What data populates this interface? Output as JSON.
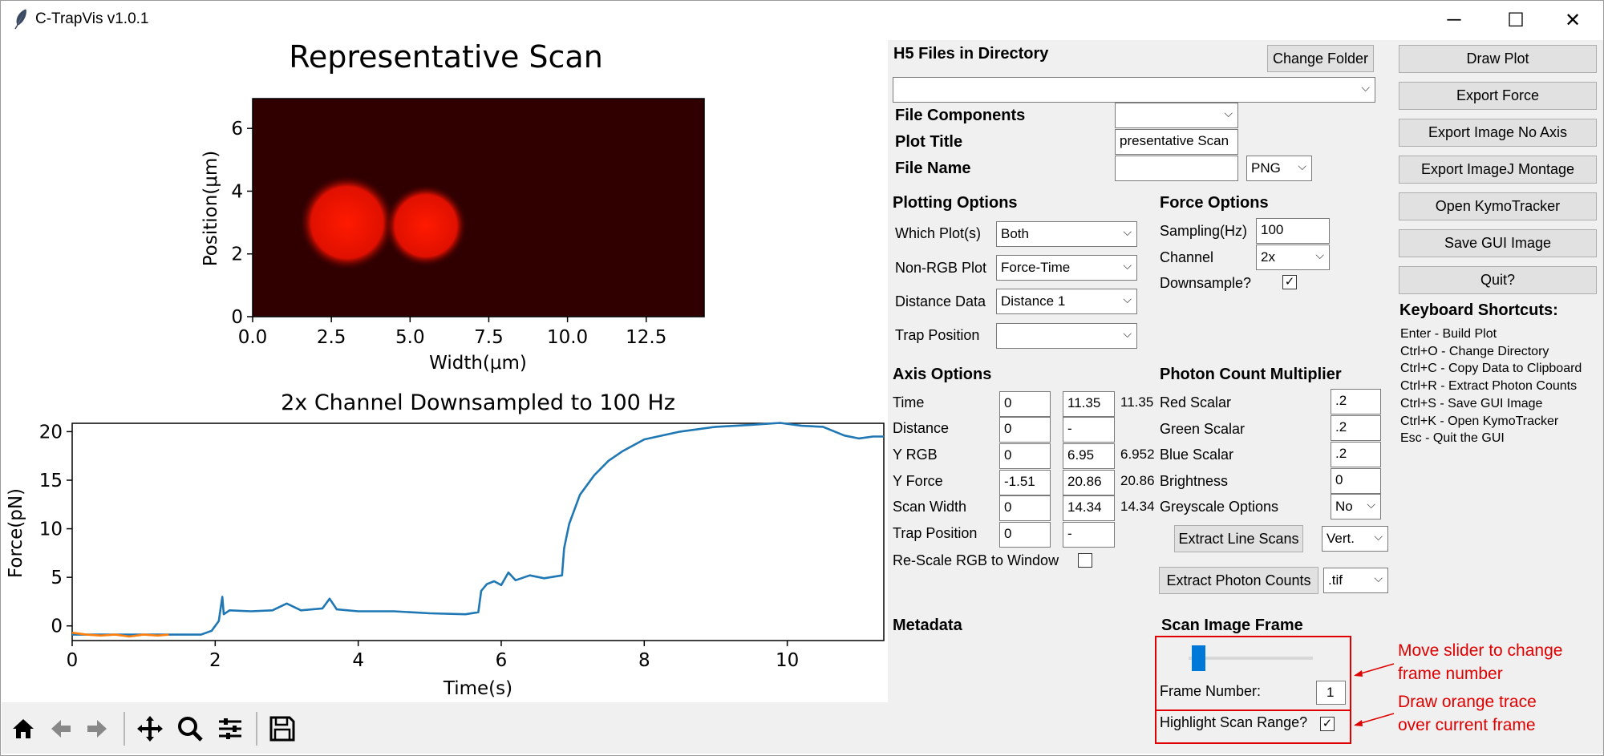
{
  "window": {
    "title": "C-TrapVis v1.0.1",
    "controls": [
      "─",
      "☐",
      "✕"
    ]
  },
  "scan_plot": {
    "title": "Representative Scan",
    "xlabel": "Width(μm)",
    "ylabel": "Position(μm)",
    "xticks": [
      "0.0",
      "2.5",
      "5.0",
      "7.5",
      "10.0",
      "12.5"
    ],
    "yticks": [
      "0",
      "2",
      "4",
      "6"
    ]
  },
  "force_plot": {
    "title": "2x Channel Downsampled to 100 Hz",
    "xlabel": "Time(s)",
    "ylabel": "Force(pN)",
    "xticks": [
      "0",
      "2",
      "4",
      "6",
      "8",
      "10"
    ],
    "yticks": [
      "0",
      "5",
      "10",
      "15",
      "20"
    ]
  },
  "chart_data": [
    {
      "type": "heatmap",
      "title": "Representative Scan",
      "xlabel": "Width(μm)",
      "ylabel": "Position(μm)",
      "xlim": [
        0,
        14.34
      ],
      "ylim": [
        0,
        6.95
      ],
      "colormap": "black-red",
      "features": [
        {
          "center_x": 3.0,
          "center_y": 3.0,
          "radius": 1.45
        },
        {
          "center_x": 5.5,
          "center_y": 2.9,
          "radius": 1.25
        }
      ]
    },
    {
      "type": "line",
      "title": "2x Channel Downsampled to 100 Hz",
      "xlabel": "Time(s)",
      "ylabel": "Force(pN)",
      "xlim": [
        0,
        11.35
      ],
      "ylim": [
        -1.51,
        20.86
      ],
      "series": [
        {
          "color": "#1f77b4",
          "x": [
            0,
            1.3,
            1.4,
            1.6,
            1.8,
            1.95,
            2.05,
            2.1,
            2.12,
            2.2,
            2.5,
            2.8,
            3.0,
            3.2,
            3.5,
            3.6,
            3.7,
            4.0,
            4.5,
            5.0,
            5.5,
            5.68,
            5.72,
            5.8,
            5.9,
            6.0,
            6.1,
            6.2,
            6.4,
            6.6,
            6.85,
            6.88,
            6.95,
            7.1,
            7.3,
            7.5,
            7.7,
            8.0,
            8.5,
            9.0,
            9.5,
            9.9,
            10.2,
            10.5,
            10.8,
            11.0,
            11.2,
            11.35
          ],
          "y": [
            -0.9,
            -0.9,
            -0.9,
            -0.9,
            -0.9,
            -0.5,
            0.5,
            3.0,
            1.2,
            1.6,
            1.5,
            1.6,
            2.3,
            1.6,
            1.8,
            2.8,
            1.7,
            1.5,
            1.5,
            1.3,
            1.2,
            1.4,
            3.6,
            4.3,
            4.6,
            4.2,
            5.5,
            4.7,
            5.2,
            4.9,
            5.2,
            8.0,
            10.5,
            13.5,
            15.5,
            17.0,
            18.0,
            19.2,
            20.0,
            20.5,
            20.7,
            20.9,
            20.6,
            20.5,
            19.6,
            19.3,
            19.5,
            19.5
          ]
        },
        {
          "color": "#ff7f0e",
          "x": [
            0,
            0.2,
            0.4,
            0.6,
            0.8,
            1.0,
            1.2,
            1.35
          ],
          "y": [
            -0.7,
            -0.9,
            -1.0,
            -0.9,
            -1.1,
            -0.9,
            -1.0,
            -0.9
          ]
        }
      ]
    }
  ],
  "toolbar": {
    "icons": [
      "home-icon",
      "back-icon",
      "forward-icon",
      "pan-icon",
      "zoom-icon",
      "configure-icon",
      "save-icon"
    ]
  },
  "files": {
    "heading": "H5 Files in Directory",
    "change_folder": "Change Folder",
    "file_selector": "",
    "components_label": "File Components",
    "components_value": "",
    "plot_title_label": "Plot Title",
    "plot_title_value": "presentative Scan",
    "file_name_label": "File Name",
    "file_name_value": "",
    "format_value": "PNG"
  },
  "plotting": {
    "heading": "Plotting Options",
    "which_label": "Which Plot(s)",
    "which_value": "Both",
    "nonrgb_label": "Non-RGB Plot",
    "nonrgb_value": "Force-Time",
    "distance_label": "Distance Data",
    "distance_value": "Distance 1",
    "trap_label": "Trap Position",
    "trap_value": ""
  },
  "force": {
    "heading": "Force Options",
    "sampling_label": "Sampling(Hz)",
    "sampling_value": "100",
    "channel_label": "Channel",
    "channel_value": "2x",
    "downsample_label": "Downsample?",
    "downsample_checked": "✓"
  },
  "axis": {
    "heading": "Axis Options",
    "rows": [
      {
        "label": "Time",
        "min": "0",
        "max": "11.35",
        "auto": "11.35"
      },
      {
        "label": "Distance",
        "min": "0",
        "max": "-",
        "auto": ""
      },
      {
        "label": "Y RGB",
        "min": "0",
        "max": "6.95",
        "auto": "6.952"
      },
      {
        "label": "Y Force",
        "min": "-1.51",
        "max": "20.86",
        "auto": "20.86"
      },
      {
        "label": "Scan Width",
        "min": "0",
        "max": "14.34",
        "auto": "14.34"
      },
      {
        "label": "Trap Position",
        "min": "0",
        "max": "-",
        "auto": ""
      }
    ],
    "rescale_label": "Re-Scale RGB to Window",
    "rescale_checked": ""
  },
  "photon": {
    "heading": "Photon Count Multiplier",
    "red_label": "Red Scalar",
    "red_value": ".2",
    "green_label": "Green Scalar",
    "green_value": ".2",
    "blue_label": "Blue Scalar",
    "blue_value": ".2",
    "brightness_label": "Brightness",
    "brightness_value": "0",
    "greyscale_label": "Greyscale Options",
    "greyscale_value": "No",
    "extract_line_scans": "Extract Line Scans",
    "line_scan_dir": "Vert.",
    "extract_photon_counts": "Extract Photon Counts",
    "photon_format": ".tif"
  },
  "metadata": {
    "heading": "Metadata"
  },
  "scan_frame": {
    "heading": "Scan Image Frame",
    "slider_fraction": 0.08,
    "frame_number_label": "Frame Number:",
    "frame_number_value": "1",
    "highlight_label": "Highlight Scan Range?",
    "highlight_checked": "✓"
  },
  "actions": {
    "draw_plot": "Draw Plot",
    "export_force": "Export Force",
    "export_image_no_axis": "Export Image No Axis",
    "export_imagej_montage": "Export ImageJ Montage",
    "open_kymotracker": "Open KymoTracker",
    "save_gui_image": "Save GUI Image",
    "quit": "Quit?"
  },
  "shortcuts": {
    "heading": "Keyboard Shortcuts:",
    "items": [
      "Enter - Build Plot",
      "Ctrl+O - Change Directory",
      "Ctrl+C - Copy Data to Clipboard",
      "Ctrl+R - Extract Photon Counts",
      "Ctrl+S - Save GUI Image",
      "Ctrl+K - Open KymoTracker",
      "Esc - Quit the GUI"
    ]
  },
  "annotations": {
    "slider_note_1": "Move slider to change",
    "slider_note_2": "frame number",
    "highlight_note_1": "Draw orange trace",
    "highlight_note_2": "over current frame",
    "color": "#e00000"
  }
}
